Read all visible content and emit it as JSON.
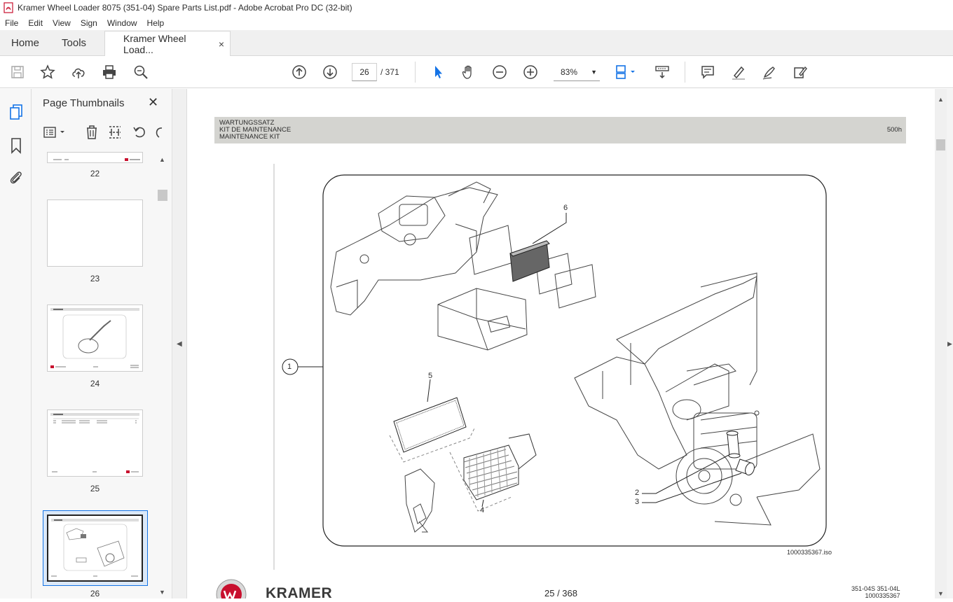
{
  "window": {
    "title": "Kramer Wheel Loader 8075 (351-04) Spare Parts List.pdf - Adobe Acrobat Pro DC (32-bit)"
  },
  "menu": [
    "File",
    "Edit",
    "View",
    "Sign",
    "Window",
    "Help"
  ],
  "tabs": {
    "home": "Home",
    "tools": "Tools",
    "document": "Kramer Wheel Load...",
    "close": "×"
  },
  "toolbar": {
    "icons": [
      "save-icon",
      "bookmark-star-icon",
      "upload-icon",
      "print-icon",
      "zoom-search-icon",
      "page-up-icon",
      "page-down-icon",
      "select-arrow-icon",
      "hand-icon",
      "zoom-out-icon",
      "zoom-in-icon",
      "fit-page-icon",
      "scroll-mode-icon",
      "comment-icon",
      "highlight-icon",
      "sign-icon",
      "edit-icon"
    ],
    "page_current": "26",
    "page_total": "/  371",
    "zoom": "83%"
  },
  "panel": {
    "title": "Page Thumbnails",
    "close": "✕",
    "thumbnails": [
      {
        "label": "22"
      },
      {
        "label": "23"
      },
      {
        "label": "24"
      },
      {
        "label": "25"
      },
      {
        "label": "26",
        "selected": true
      }
    ]
  },
  "document": {
    "header_lines": [
      "WARTUNGSSATZ",
      "KIT DE MAINTENANCE",
      "MAINTENANCE KIT"
    ],
    "header_right": "500h",
    "callouts": [
      "1",
      "2",
      "3",
      "4",
      "5",
      "6"
    ],
    "iso_label": "1000335367.iso",
    "brand": "KRAMER",
    "page_number": "25 / 368",
    "code_line1": "351-04S   351-04L",
    "code_line2": "1000335367"
  },
  "colors": {
    "accent": "#1473e6",
    "selected_thumb": "#1473e6",
    "header_band": "#d4d4d0",
    "kramer_red": "#c8102e"
  }
}
